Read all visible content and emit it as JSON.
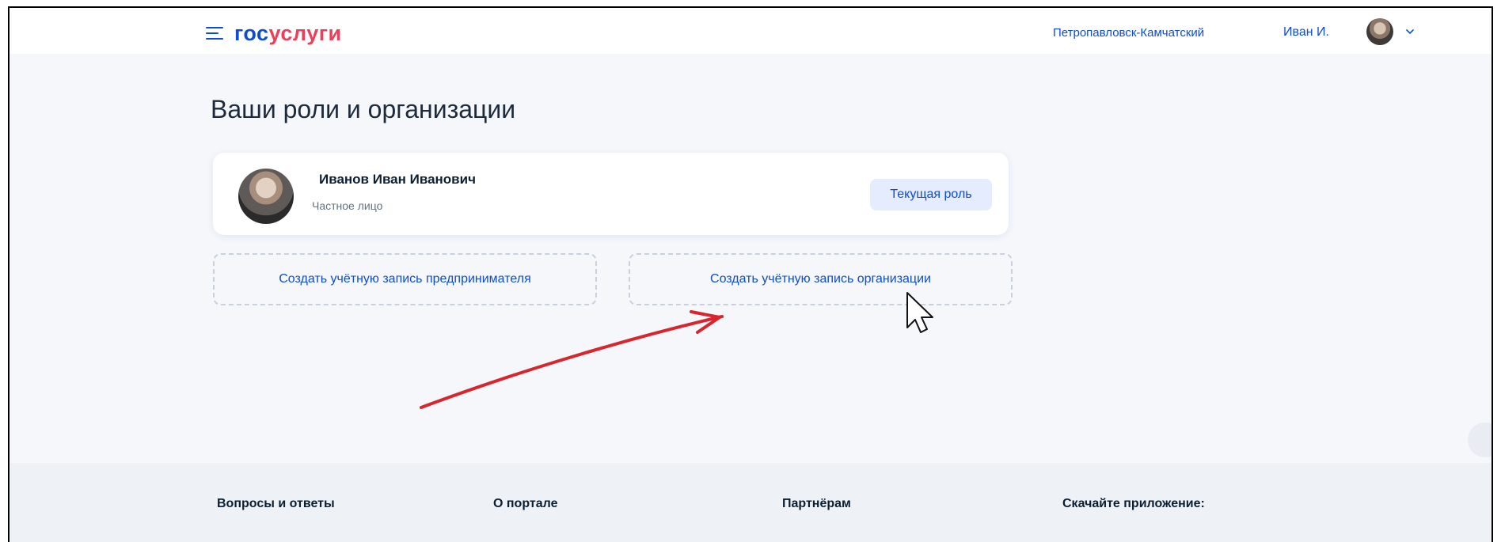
{
  "header": {
    "logo_part1": "гос",
    "logo_part2": "услуги",
    "city": "Петропавловск-Камчатский",
    "user_short": "Иван И."
  },
  "main": {
    "title": "Ваши роли и организации",
    "role_card": {
      "name": "Иванов  Иван Иванович",
      "type": "Частное лицо",
      "badge": "Текущая роль"
    },
    "create_entrepreneur": "Создать учётную запись предпринимателя",
    "create_organization": "Создать учётную запись организации"
  },
  "footer": {
    "faq": "Вопросы и ответы",
    "about": "О портале",
    "partners": "Партнёрам",
    "app": "Скачайте приложение:"
  },
  "colors": {
    "brand_blue": "#0d4cd3",
    "brand_red": "#ee3f58",
    "annotation_arrow": "#d7262e"
  },
  "icons": [
    "menu-icon",
    "chevron-down-icon",
    "avatar",
    "mouse-cursor-icon",
    "chat-icon"
  ]
}
